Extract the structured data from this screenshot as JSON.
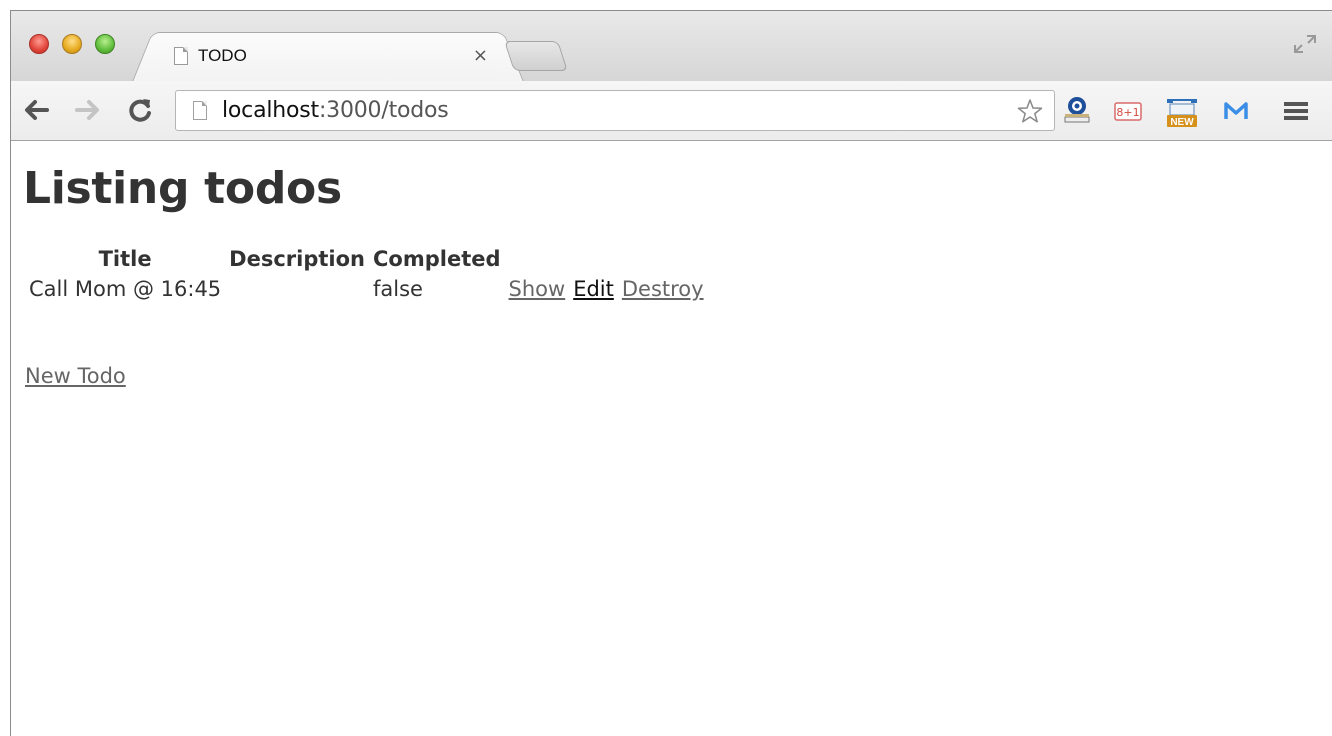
{
  "browser": {
    "tab": {
      "title": "TODO",
      "close": "×"
    },
    "address": {
      "host": "localhost",
      "path": ":3000/todos"
    }
  },
  "page": {
    "heading": "Listing todos",
    "table": {
      "headers": [
        "Title",
        "Description",
        "Completed"
      ],
      "rows": [
        {
          "title": "Call Mom @ 16:45",
          "description": "",
          "completed": "false",
          "actions": {
            "show": "Show",
            "edit": "Edit",
            "destroy": "Destroy"
          }
        }
      ]
    },
    "new_link": "New Todo"
  },
  "icons": {
    "back": "arrow-left-icon",
    "forward": "arrow-right-icon",
    "reload": "reload-icon",
    "star": "star-icon",
    "menu": "hamburger-menu-icon"
  }
}
